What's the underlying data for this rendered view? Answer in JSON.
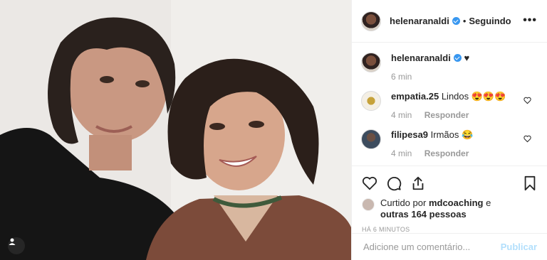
{
  "post": {
    "author": {
      "username": "helenaranaldi",
      "follow_state": "Seguindo",
      "separator": "•"
    },
    "caption": {
      "username": "helenaranaldi",
      "text": "♥",
      "age": "6 min"
    },
    "comments": [
      {
        "username": "empatia.25",
        "text": "Lindos 😍😍😍",
        "age": "4 min",
        "reply_label": "Responder"
      },
      {
        "username": "filipesa9",
        "text": "Irmãos 😂",
        "age": "4 min",
        "reply_label": "Responder"
      }
    ],
    "likes": {
      "prefix": "Curtido por",
      "user": "mdcoaching",
      "middle": "e",
      "others": "outras 164 pessoas"
    },
    "timestamp": "HÁ 6 MINUTOS",
    "comment_input": {
      "placeholder": "Adicione um comentário...",
      "value": ""
    },
    "publish_label": "Publicar",
    "more_label": "•••"
  },
  "icons": {
    "user_tag": "user-tag-icon",
    "more": "more-options-icon",
    "verified": "verified-badge-icon",
    "like": "heart-icon",
    "comment": "comment-icon",
    "share": "share-icon",
    "save": "bookmark-icon"
  },
  "colors": {
    "verified": "#3897f0",
    "muted": "#999999",
    "publish": "#b2dffc",
    "text": "#262626"
  }
}
